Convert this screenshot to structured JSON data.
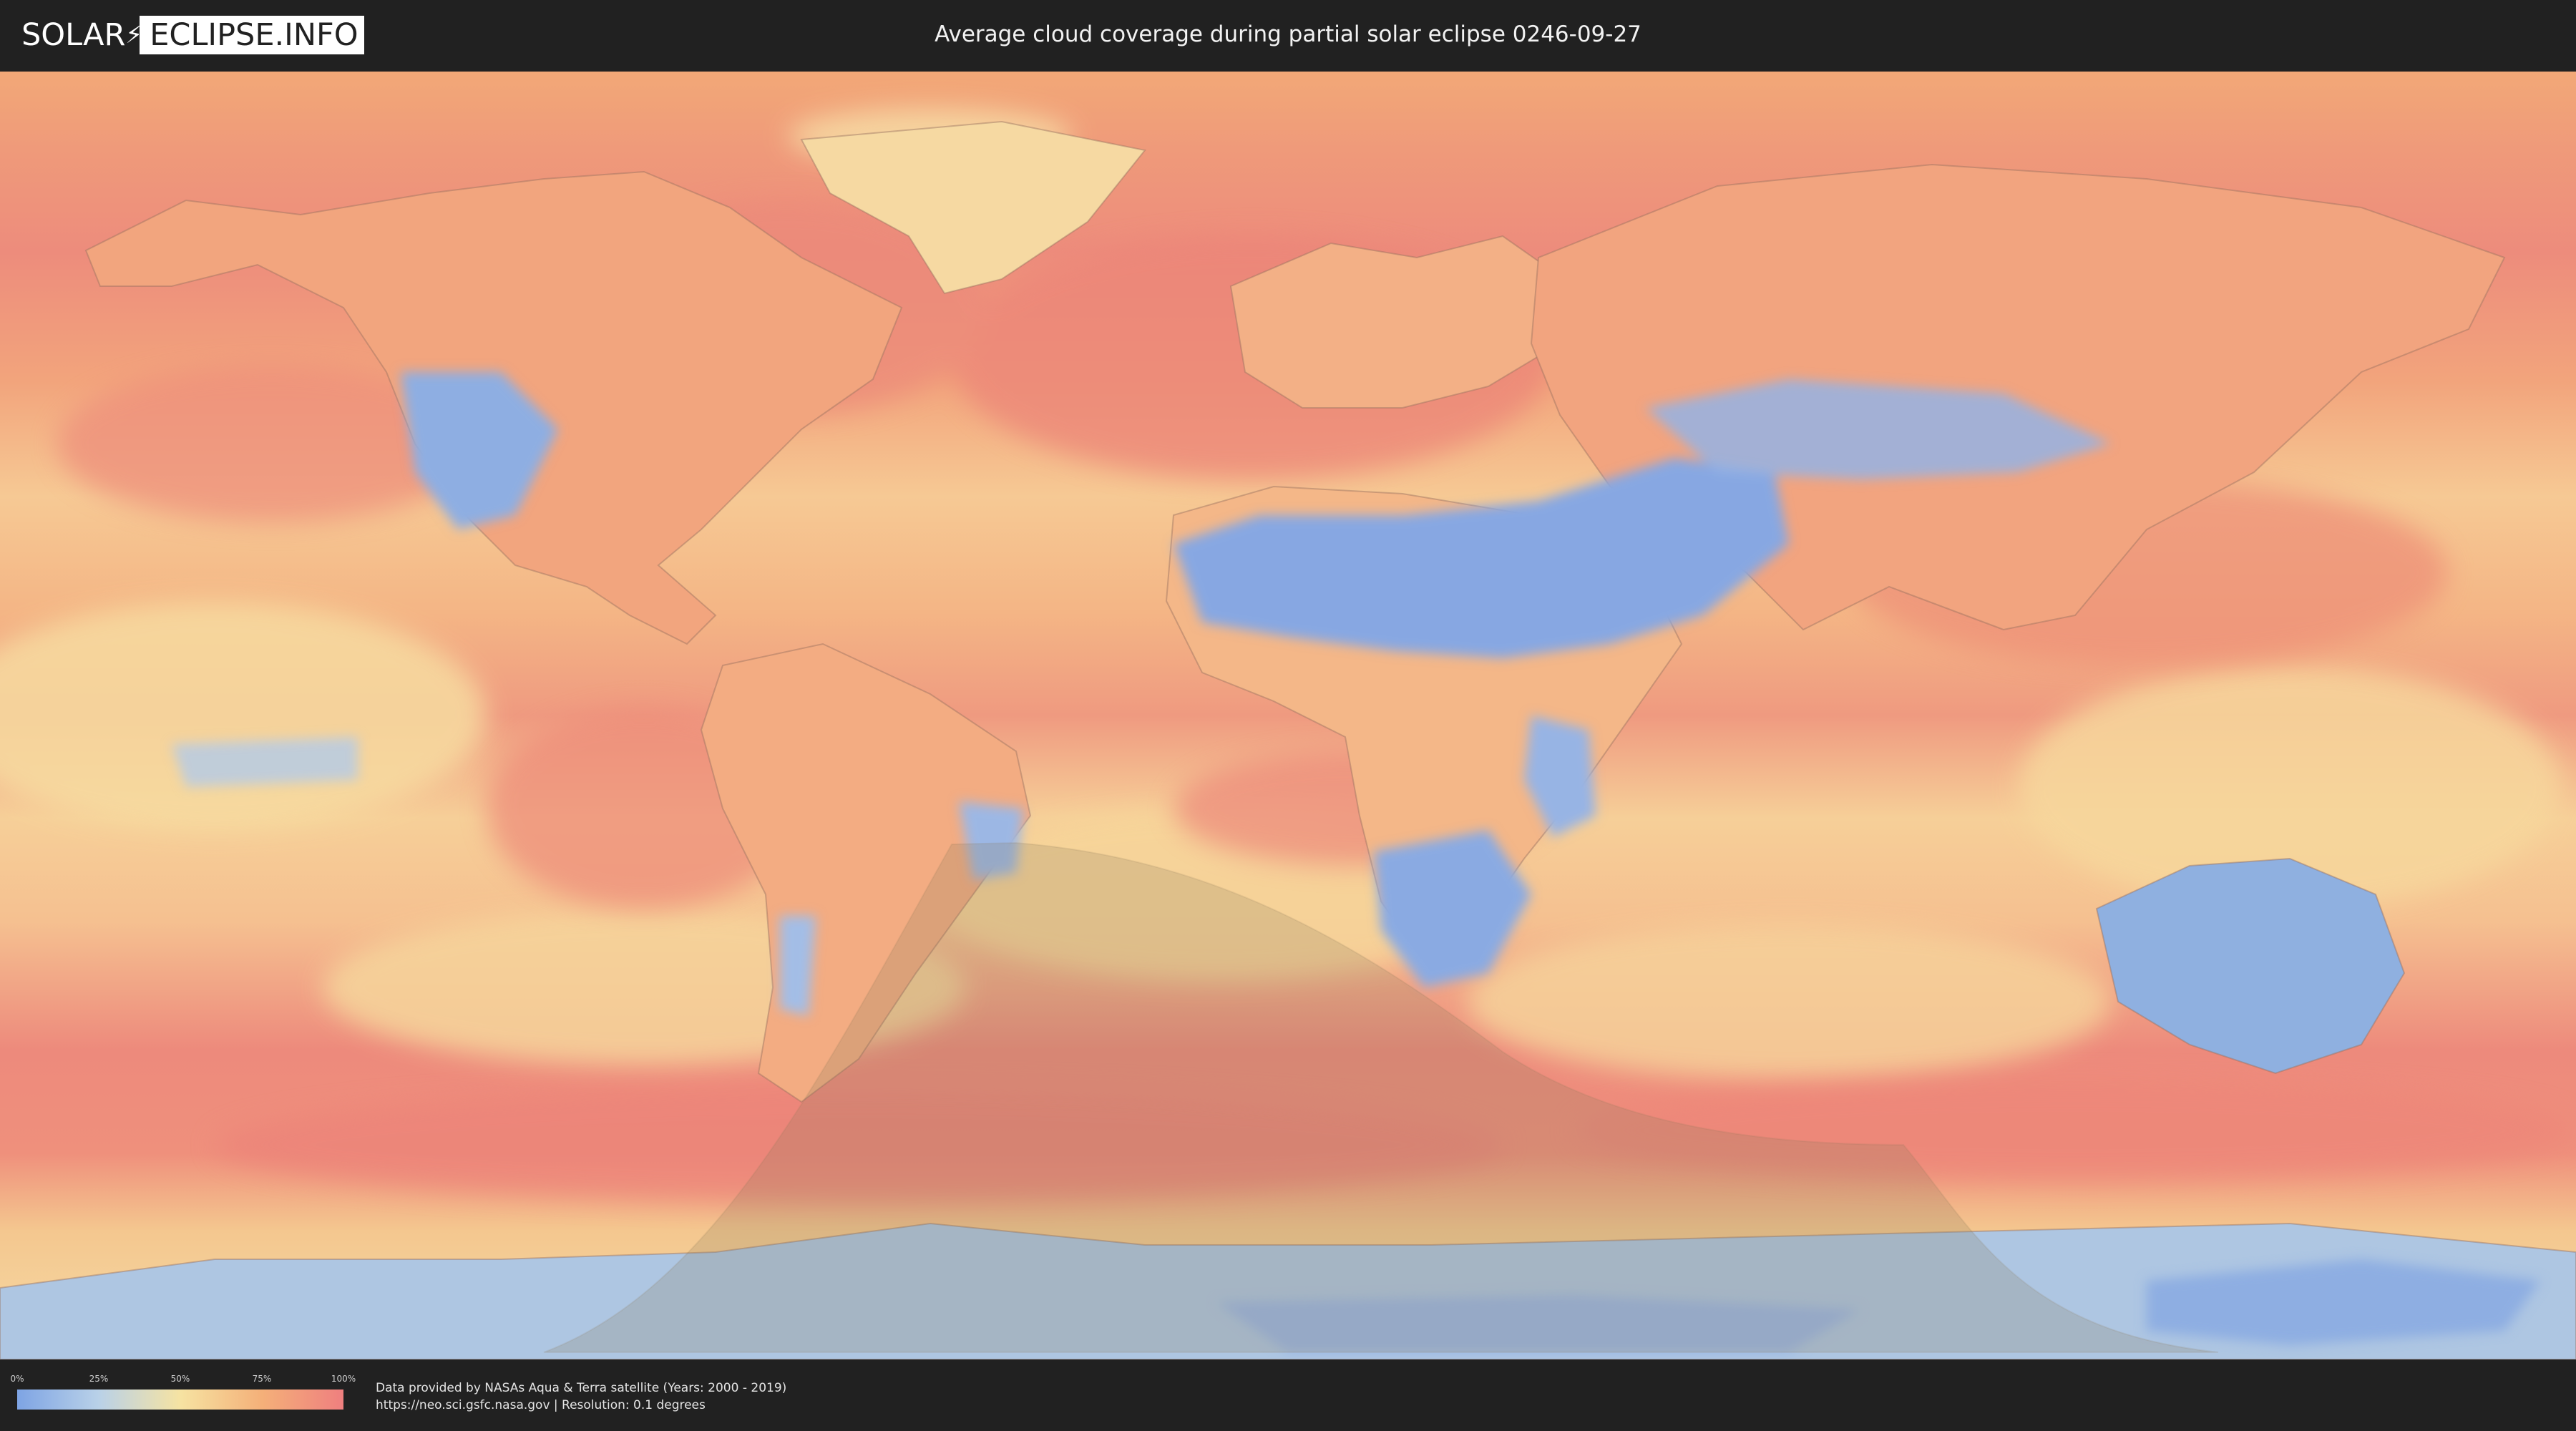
{
  "header": {
    "logo_left": "SOLAR",
    "logo_right": "ECLIPSE.INFO",
    "title": "Average cloud coverage during partial solar eclipse 0246-09-27"
  },
  "map": {
    "description_icon": "world-cloud-cover-map",
    "colors": {
      "clear": "#7ea4e4",
      "low": "#b9d1e8",
      "mid": "#f6e3a2",
      "high": "#f4b079",
      "overcast": "#ef7f7f",
      "eclipse_shadow": "#8a7a5a"
    }
  },
  "legend": {
    "ticks": [
      "0%",
      "25%",
      "50%",
      "75%",
      "100%"
    ],
    "tick_fractions": [
      0,
      0.25,
      0.5,
      0.75,
      1.0
    ]
  },
  "footer": {
    "credit_line1": "Data provided by NASAs Aqua & Terra satellite (Years: 2000 - 2019)",
    "credit_line2": "https://neo.sci.gsfc.nasa.gov | Resolution: 0.1 degrees"
  }
}
